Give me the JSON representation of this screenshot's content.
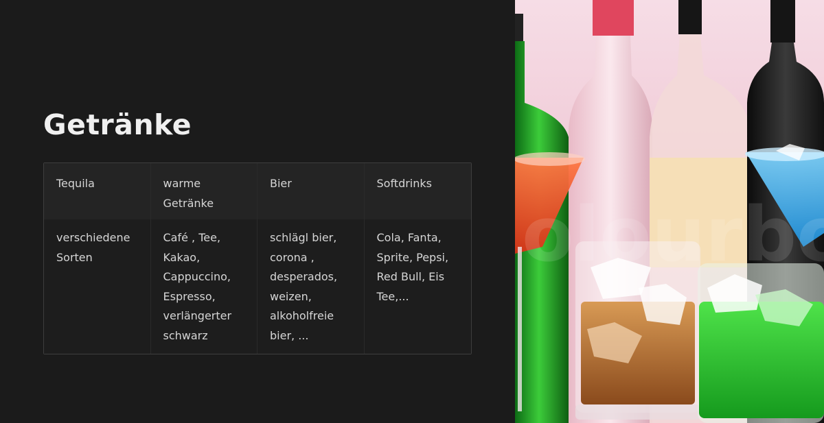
{
  "slide": {
    "title": "Getränke"
  },
  "table": {
    "headers": [
      "Tequila",
      "warme Getränke",
      "Bier",
      "Softdrinks"
    ],
    "rows": [
      [
        "verschiedene Sorten",
        "Café , Tee, Kakao, Cappuccino, Espresso, verlängerter schwarz",
        "schlägl bier, corona , desperados, weizen, alkoholfreie bier, ...",
        "Cola, Fanta, Sprite, Pepsi, Red Bull, Eis Tee,..."
      ]
    ]
  },
  "photo": {
    "subject": "bottles and cocktail glasses",
    "colors": {
      "background": "#f2d4de",
      "green": "#2fb32f",
      "red": "#e94a2a",
      "blue": "#3ba8e8",
      "amber": "#c98a4a"
    }
  }
}
